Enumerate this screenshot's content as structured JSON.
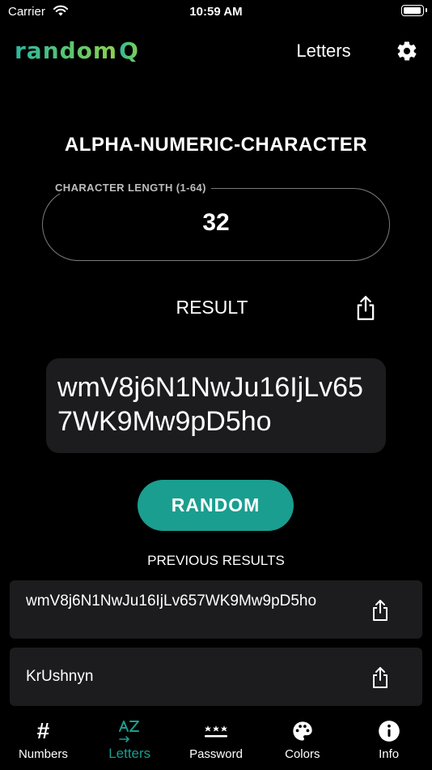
{
  "status_bar": {
    "carrier": "Carrier",
    "time": "10:59 AM",
    "battery_level": 0.95
  },
  "header": {
    "logo_text": "random",
    "logo_q": "Q",
    "title": "Letters"
  },
  "mode_title": "ALPHA-NUMERIC-CHARACTER",
  "length_field": {
    "label": "CHARACTER LENGTH (1-64)",
    "value": "32"
  },
  "result": {
    "label": "RESULT",
    "value": "wmV8j6N1NwJu16IjLv657WK9Mw9pD5ho"
  },
  "random_button": "RANDOM",
  "previous": {
    "title": "PREVIOUS RESULTS",
    "items": [
      {
        "value": "wmV8j6N1NwJu16IjLv657WK9Mw9pD5ho"
      },
      {
        "value": "KrUshnyn"
      }
    ]
  },
  "tabs": [
    {
      "label": "Numbers",
      "icon": "hash-icon"
    },
    {
      "label": "Letters",
      "icon": "letters-az-icon",
      "active": true
    },
    {
      "label": "Password",
      "icon": "password-icon"
    },
    {
      "label": "Colors",
      "icon": "palette-icon"
    },
    {
      "label": "Info",
      "icon": "info-icon"
    }
  ],
  "colors": {
    "accent": "#1a9e8f",
    "surface": "#1c1c1e",
    "background": "#000000",
    "logo_gradient_start": "#2fb5a0",
    "logo_gradient_end": "#8fd04f"
  }
}
